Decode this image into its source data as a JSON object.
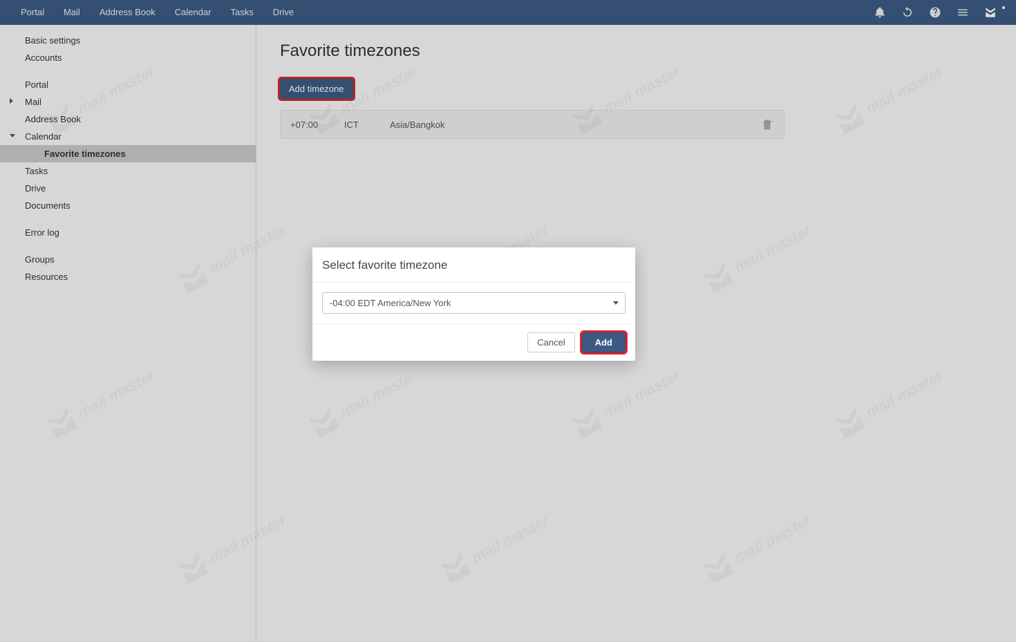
{
  "navbar": {
    "items": [
      "Portal",
      "Mail",
      "Address Book",
      "Calendar",
      "Tasks",
      "Drive"
    ]
  },
  "sidebar": {
    "basic": "Basic settings",
    "accounts": "Accounts",
    "portal": "Portal",
    "mail": "Mail",
    "addressbook": "Address Book",
    "calendar": "Calendar",
    "favtz": "Favorite timezones",
    "tasks": "Tasks",
    "drive": "Drive",
    "documents": "Documents",
    "errorlog": "Error log",
    "groups": "Groups",
    "resources": "Resources"
  },
  "page": {
    "title": "Favorite timezones",
    "add_btn": "Add timezone"
  },
  "timezones": [
    {
      "offset": "+07:00",
      "abbr": "ICT",
      "name": "Asia/Bangkok"
    }
  ],
  "modal": {
    "title": "Select favorite timezone",
    "selected": "-04:00 EDT America/New York",
    "cancel": "Cancel",
    "add": "Add"
  },
  "watermark": {
    "text": "mail master"
  }
}
